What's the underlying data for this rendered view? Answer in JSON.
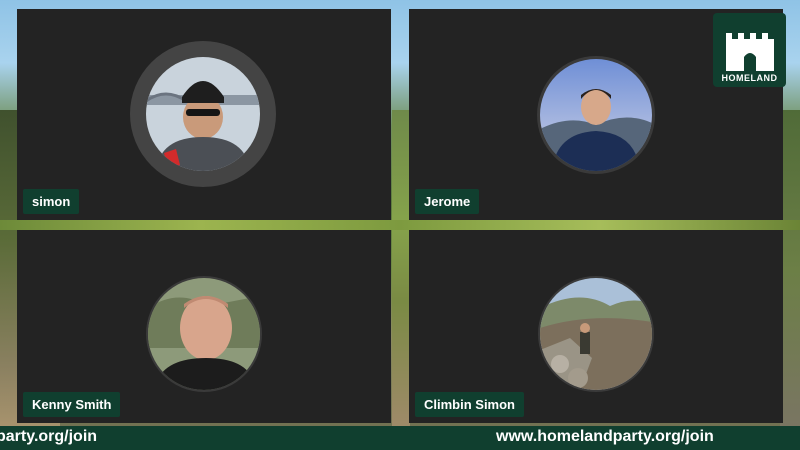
{
  "participants": [
    {
      "name": "simon",
      "avatar_icon": "person-in-beanie-photo"
    },
    {
      "name": "Jerome",
      "avatar_icon": "person-outdoors-photo"
    },
    {
      "name": "Kenny Smith",
      "avatar_icon": "person-close-up-photo"
    },
    {
      "name": "Climbin Simon",
      "avatar_icon": "hiker-on-rocks-photo"
    }
  ],
  "logo": {
    "text": "HOMELAND",
    "icon": "castle-icon"
  },
  "footer": {
    "ticker_left": "party.org/join",
    "ticker_right": "www.homelandparty.org/join"
  },
  "colors": {
    "brand_green": "#103f2f",
    "tile_background": "#232323",
    "text": "#ffffff"
  }
}
